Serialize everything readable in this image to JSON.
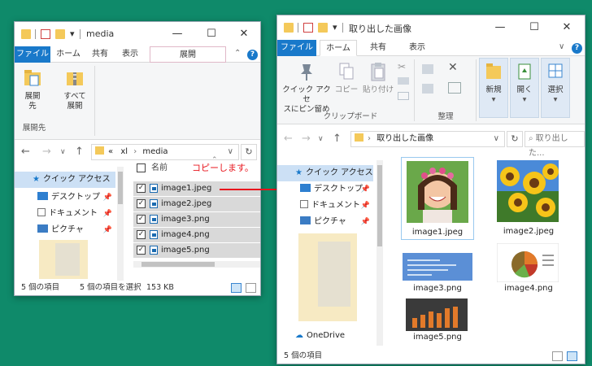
{
  "left_window": {
    "title": "media",
    "tabs": [
      {
        "label": "ファイル"
      },
      {
        "label": "ホーム"
      },
      {
        "label": "共有"
      },
      {
        "label": "表示"
      },
      {
        "label": "展開"
      }
    ],
    "ribbon": {
      "expand_to_label": "展開\n先",
      "expand_all_label": "すべて\n展開",
      "group_label": "展開先"
    },
    "address": {
      "prefix": "«",
      "segments": [
        "xl",
        "media"
      ]
    },
    "nav": {
      "quick_access": "クイック アクセス",
      "items": [
        "デスクトップ",
        "ドキュメント",
        "ピクチャ"
      ]
    },
    "list": {
      "header": "名前",
      "files": [
        "image1.jpeg",
        "image2.jpeg",
        "image3.png",
        "image4.png",
        "image5.png"
      ]
    },
    "status": {
      "count": "5 個の項目",
      "selected": "5 個の項目を選択",
      "size": "153 KB"
    }
  },
  "annotation": {
    "copy_note": "コピーします。",
    "arrow_color": "#e8141c"
  },
  "right_window": {
    "title": "取り出した画像",
    "tabs": [
      {
        "label": "ファイル"
      },
      {
        "label": "ホーム"
      },
      {
        "label": "共有"
      },
      {
        "label": "表示"
      }
    ],
    "ribbon": {
      "pin_label": "クイック アクセ\nスにピン留め",
      "copy_label": "コピー",
      "paste_label": "貼り付け",
      "clipboard_group": "クリップボード",
      "organize_group": "整理",
      "new_label": "新規",
      "open_label": "開く",
      "select_label": "選択"
    },
    "address": {
      "segments": [
        "取り出した画像"
      ]
    },
    "search_placeholder": "取り出した...",
    "nav": {
      "quick_access": "クイック アクセス",
      "items": [
        "デスクトップ",
        "ドキュメント",
        "ピクチャ"
      ],
      "onedrive": "OneDrive"
    },
    "thumbnails": [
      {
        "caption": "image1.jpeg"
      },
      {
        "caption": "image2.jpeg"
      },
      {
        "caption": "image3.png"
      },
      {
        "caption": "image4.png"
      },
      {
        "caption": "image5.png"
      }
    ],
    "status": {
      "count": "5 個の項目"
    }
  },
  "colors": {
    "background": "#0f8a6a",
    "accent_blue": "#1979ca",
    "selection": "#cce0f5",
    "annotation_red": "#e8141c"
  }
}
